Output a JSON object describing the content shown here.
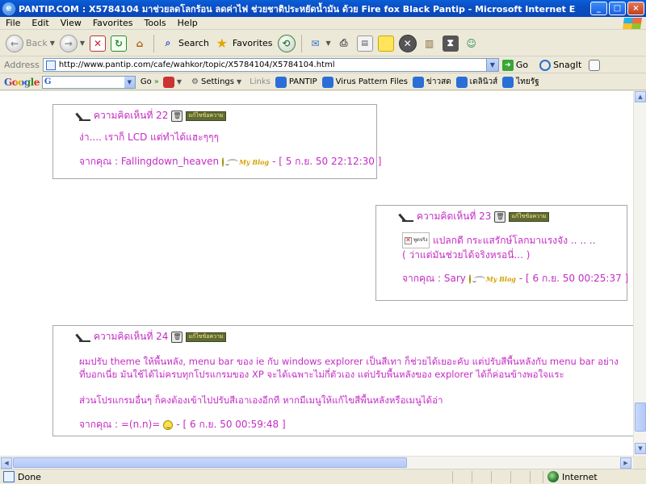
{
  "window": {
    "title": "PANTIP.COM : X5784104 มาช่วยลดโลกร้อน ลดค่าไฟ ช่วยชาติประหยัดน้ำมัน ด้วย Fire fox Black Pantip  - Microsoft Internet Explorer",
    "ie_icon": "e",
    "minimize": "_",
    "maximize": "□",
    "close": "×"
  },
  "menu": [
    "File",
    "Edit",
    "View",
    "Favorites",
    "Tools",
    "Help"
  ],
  "toolbar": {
    "back_label": "Back",
    "search_label": "Search",
    "favorites_label": "Favorites"
  },
  "address": {
    "label": "Address",
    "url": "http://www.pantip.com/cafe/wahkor/topic/X5784104/X5784104.html",
    "go_label": "Go",
    "snagit_label": "SnagIt"
  },
  "googlebar": {
    "logo": "Google",
    "go_label": "Go",
    "settings_label": "Settings",
    "links_label": "Links",
    "links": [
      "PANTIP",
      "Virus Pattern Files",
      "ข่าวสด",
      "เดลินิวส์",
      "ไทยรัฐ"
    ]
  },
  "comments": [
    {
      "heading": "ความคิดเห็นที่ 22",
      "edit_badge": "แก้ไขข้อความ",
      "body": [
        "ง่า.... เราก็ LCD แต่ทำได้แฮะๆๆๆ"
      ],
      "author_prefix": "จากคุณ : Fallingdown_heaven",
      "blog_label": "My Blog",
      "author_suffix": "- [ 5 ก.ย. 50 22:12:30 ]"
    },
    {
      "heading": "ความคิดเห็นที่ 23",
      "edit_badge": "แก้ไขข้อความ",
      "image_alt": "พูดจริง",
      "body": [
        "แปลกดี กระแสรักษ์โลกมาแรงจัง .. .. ..",
        "( ว่าแต่มันช่วยได้จริงหรอนี่... )"
      ],
      "author_prefix": "จากคุณ : Sary",
      "blog_label": "My Blog",
      "author_suffix": "- [ 6 ก.ย. 50 00:25:37 ]"
    },
    {
      "heading": "ความคิดเห็นที่ 24",
      "edit_badge": "แก้ไขข้อความ",
      "body": [
        "ผมปรับ theme ให้พื้นหลัง, menu bar ของ ie กับ windows explorer เป็นสีเทา ก็ช่วยได้เยอะคับ  แต่ปรับสีพื้นหลังกับ menu bar อย่าง",
        "ที่บอกเนี่ย มันใช้ได้ไม่ครบทุกโปรแกรมของ XP  จะได้เฉพาะไม่กี่ตัวเอง   แต่ปรับพื้นหลังของ explorer ได้ก็ค่อนข้างพอใจแระ",
        "",
        "ส่วนโปรแกรมอื่นๆ ก็คงต้องเข้าไปปรับสีเอาเองอีกที หากมีเมนูให้แก้ไขสีพื้นหลังหรือเมนูได้อ่า"
      ],
      "author_prefix": "จากคุณ : =(n.n)=",
      "author_suffix": "- [ 6 ก.ย. 50 00:59:48 ]"
    }
  ],
  "status": {
    "text": "Done",
    "zone": "Internet"
  },
  "colors": {
    "comment_text": "#c42bc4",
    "comment_border": "#a7a6aa",
    "xp_title_blue": "#0a5fd8"
  }
}
